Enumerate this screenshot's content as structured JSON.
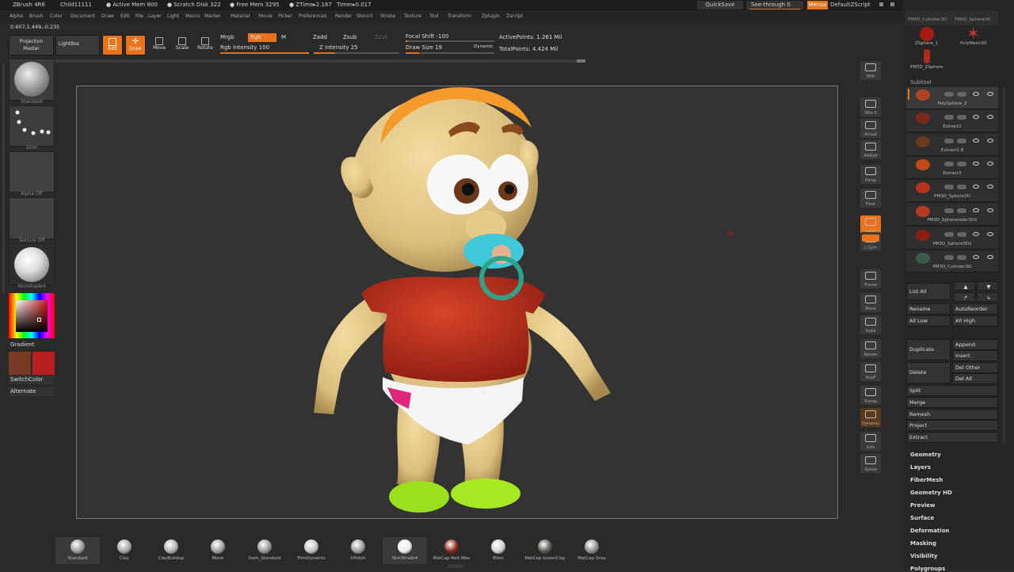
{
  "titlebar": {
    "app": "ZBrush 4R6",
    "doc": "Child11111",
    "active_mem": "● Active Mem 800",
    "scratch": "● Scratch Disk 322",
    "free_mem": "● Free Mem 3295",
    "ztime": "● ZTime▸2.187",
    "timer": "Timer▸0.017",
    "quicksave": "QuickSave",
    "seethrough": "See-through",
    "seethrough_val": "0",
    "menus": "Menus",
    "script": "DefaultZScript"
  },
  "menus": [
    "Alpha",
    "Brush",
    "Color",
    "Document",
    "Draw",
    "Edit",
    "File",
    "Layer",
    "Light",
    "Macro",
    "Marker",
    "Material",
    "Movie",
    "Picker",
    "Preferences",
    "Render",
    "Stencil",
    "Stroke",
    "Texture",
    "Tool",
    "Transform",
    "Zplugin",
    "Zscript"
  ],
  "coords": "0.607,1.449,-0.235",
  "toolbar": {
    "projection": "Projection",
    "master": "Master",
    "lightbox": "LightBox",
    "edit": "Edit",
    "draw": "Draw",
    "move": "Move",
    "scale": "Scale",
    "rotate": "Rotate",
    "mrgb": "Mrgb",
    "rgb": "Rgb",
    "m": "M",
    "rgb_intensity": "Rgb Intensity 100",
    "zadd": "Zadd",
    "zsub": "Zsub",
    "zcut": "Zcut",
    "z_intensity": "Z Intensity 25",
    "focal_shift": "Focal Shift -100",
    "draw_size": "Draw Size 19",
    "dynamic": "Dynamic",
    "active_points": "ActivePoints: 1.261 Mil",
    "total_points": "TotalPoints: 4.424 Mil"
  },
  "sliders": {
    "rgb_intensity": 100,
    "z_intensity": 25,
    "focal_shift": -100,
    "draw_size": 19
  },
  "leftpanel": {
    "brush": "Standard",
    "stroke": "Dots",
    "alpha": "Alpha Off",
    "texture": "Texture Off",
    "material": "SkinShade4",
    "gradient": "Gradient",
    "switchcolor": "SwitchColor",
    "alternate": "Alternate",
    "main_color": "#7a3b22",
    "secondary_color": "#b8201e"
  },
  "righttoolbar": [
    "BPR",
    "SPix 3",
    "Actual",
    "AAHalf",
    "Persp",
    "Floor",
    "Local",
    "L.Sym",
    "Frame",
    "Move",
    "Scale",
    "Rotate",
    "PolyF",
    "Transp",
    "Dynamic",
    "Solo",
    "Xpose"
  ],
  "rightpanel": {
    "top_tools": [
      "PM3D_Cylinder3D",
      "PM3D_Sphere3D",
      "ZSphere_1",
      "PolyMesh3D",
      "PM3D_ZSphere"
    ],
    "subtool_title": "Subtool",
    "subtools": [
      "PolySphere_2",
      "Extract2",
      "Extract1 8",
      "Extract3",
      "PM3D_Sphere3D",
      "PM3D_Sphereinder3D1",
      "PM3D_Sphere3D1",
      "PM3D_Cylinder3D"
    ],
    "list_all": "List All",
    "rename": "Rename",
    "autoreorder": "AutoReorder",
    "all_low": "All Low",
    "all_high": "All High",
    "duplicate": "Duplicate",
    "append": "Append",
    "insert": "Insert",
    "delete": "Delete",
    "del_other": "Del Other",
    "del_all": "Del All",
    "split": "Split",
    "merge": "Merge",
    "remesh": "Remesh",
    "project": "Project",
    "extract": "Extract",
    "menus": [
      "Geometry",
      "Layers",
      "FiberMesh",
      "Geometry HD",
      "Preview",
      "Surface",
      "Deformation",
      "Masking",
      "Visibility",
      "Polygroups"
    ]
  },
  "shelf": [
    {
      "name": "Standard",
      "color": "#9a9a9a"
    },
    {
      "name": "Clay",
      "color": "#a5a5a5"
    },
    {
      "name": "ClayBuildup",
      "color": "#b0b0b0"
    },
    {
      "name": "Move",
      "color": "#9e9e9e"
    },
    {
      "name": "Dam_Standard",
      "color": "#959595"
    },
    {
      "name": "TrimDynamic",
      "color": "#c2c2c2"
    },
    {
      "name": "hPolish",
      "color": "#999999"
    },
    {
      "name": "SkinShade4",
      "color": "#ececec"
    },
    {
      "name": "MatCap Red Wax",
      "color": "#8a2418"
    },
    {
      "name": "Blinn",
      "color": "#cfcfcf"
    },
    {
      "name": "MatCap GreenClay",
      "color": "#565a4e"
    },
    {
      "name": "MatCap Gray",
      "color": "#8d8d8d"
    }
  ]
}
